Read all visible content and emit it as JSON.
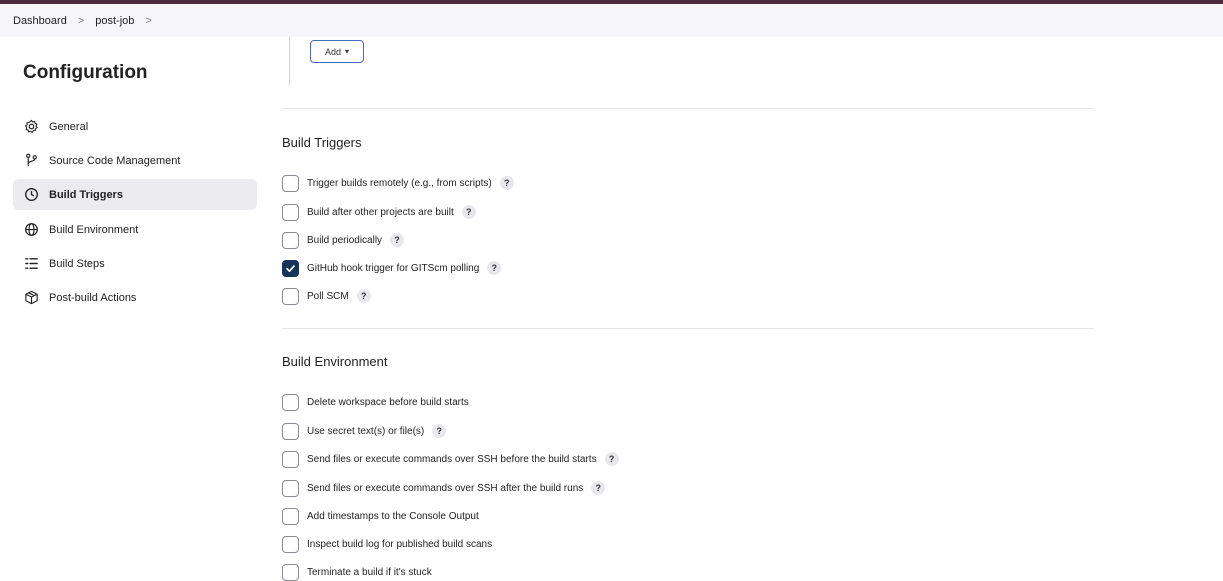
{
  "breadcrumb": {
    "items": [
      "Dashboard",
      "post-job"
    ],
    "separator": ">"
  },
  "sidebar": {
    "title": "Configuration",
    "items": [
      {
        "label": "General",
        "icon": "gear-icon"
      },
      {
        "label": "Source Code Management",
        "icon": "branch-icon"
      },
      {
        "label": "Build Triggers",
        "icon": "clock-icon",
        "active": true
      },
      {
        "label": "Build Environment",
        "icon": "globe-icon"
      },
      {
        "label": "Build Steps",
        "icon": "list-icon"
      },
      {
        "label": "Post-build Actions",
        "icon": "package-icon"
      }
    ]
  },
  "add_button": {
    "label": "Add",
    "caret": "▾"
  },
  "build_triggers": {
    "title": "Build Triggers",
    "options": [
      {
        "label": "Trigger builds remotely (e.g., from scripts)",
        "checked": false,
        "help": "?"
      },
      {
        "label": "Build after other projects are built",
        "checked": false,
        "help": "?"
      },
      {
        "label": "Build periodically",
        "checked": false,
        "help": "?"
      },
      {
        "label": "GitHub hook trigger for GITScm polling",
        "checked": true,
        "help": "?"
      },
      {
        "label": "Poll SCM",
        "checked": false,
        "help": "?"
      }
    ]
  },
  "build_environment": {
    "title": "Build Environment",
    "options": [
      {
        "label": "Delete workspace before build starts",
        "checked": false
      },
      {
        "label": "Use secret text(s) or file(s)",
        "checked": false,
        "help": "?"
      },
      {
        "label": "Send files or execute commands over SSH before the build starts",
        "checked": false,
        "help": "?"
      },
      {
        "label": "Send files or execute commands over SSH after the build runs",
        "checked": false,
        "help": "?"
      },
      {
        "label": "Add timestamps to the Console Output",
        "checked": false
      },
      {
        "label": "Inspect build log for published build scans",
        "checked": false
      },
      {
        "label": "Terminate a build if it's stuck",
        "checked": false
      }
    ]
  },
  "colors": {
    "accent": "#14345a",
    "topbar": "#4b2a3a",
    "button_border": "#4a6bb5"
  }
}
